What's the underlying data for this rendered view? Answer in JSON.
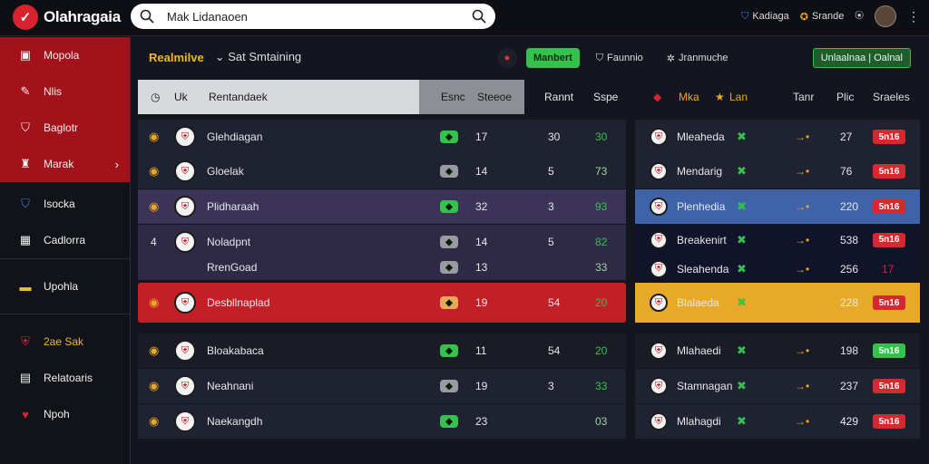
{
  "app": {
    "title": "Olahragaia"
  },
  "search": {
    "value": "Mak Lidanaoen",
    "placeholder": "Search"
  },
  "top": {
    "item1": "Kadiaga",
    "item2": "Srande"
  },
  "sidebar": {
    "items": [
      {
        "label": "Mopola",
        "icon": "ball-icon"
      },
      {
        "label": "Nlis",
        "icon": "pen-icon"
      },
      {
        "label": "Baglotr",
        "icon": "shield-icon"
      },
      {
        "label": "Marak",
        "icon": "trophy-icon"
      },
      {
        "label": "Isocka",
        "icon": "shield-icon"
      },
      {
        "label": "Cadlorra",
        "icon": "card-icon"
      },
      {
        "label": "Upohla",
        "icon": "flag-icon"
      },
      {
        "label": "2ae Sak",
        "icon": "badge-icon"
      },
      {
        "label": "Relatoaris",
        "icon": "calendar-icon"
      },
      {
        "label": "Npoh",
        "icon": "heart-icon"
      }
    ]
  },
  "toolbar": {
    "title": "Realmilve",
    "dropdown": "Sat Smtaining",
    "pill_green": "Manbert",
    "pill1": "Faunnio",
    "pill2": "Jranmuche",
    "update_label": "Unlaalnaa | Oalnal"
  },
  "table_left": {
    "headers": {
      "ul": "Uk",
      "team": "Rentandaek",
      "c1": "Esnc",
      "c2": "Steeoe",
      "c3": "Rannt",
      "c4": "Sspe"
    }
  },
  "table_right": {
    "headers": {
      "h1": "Mka",
      "h2": "Lan",
      "h3": "Tanr",
      "h4": "Plic",
      "h5": "Sraeles"
    }
  },
  "left_rows": [
    {
      "pos": "",
      "team": "Glehdiagan",
      "badge": "17",
      "c2": "30",
      "c3": "30",
      "c4": "30"
    },
    {
      "pos": "",
      "team": "Gloelak",
      "badge": "14",
      "c2": "5",
      "c3": "5",
      "c4": "73"
    },
    {
      "pos": "",
      "team": "Plidharaah",
      "badge": "32",
      "c2": "3",
      "c3": "3",
      "c4": "93"
    },
    {
      "pos": "4",
      "team": "Noladpnt",
      "badge": "14",
      "c2": "5",
      "c3": "5",
      "c4": "82"
    },
    {
      "pos": "",
      "team": "RrenGoad",
      "badge": "13",
      "c2": "",
      "c3": "",
      "c4": "33"
    },
    {
      "pos": "",
      "team": "Desbllnaplad",
      "badge": "19",
      "c2": "54",
      "c3": "54",
      "c4": "20"
    },
    {
      "pos": "",
      "team": "Bloakabaca",
      "badge": "11",
      "c2": "54",
      "c3": "54",
      "c4": "20"
    },
    {
      "pos": "",
      "team": "Neahnani",
      "badge": "19",
      "c2": "3",
      "c3": "3",
      "c4": "33"
    },
    {
      "pos": "",
      "team": "Naekangdh",
      "badge": "23",
      "c2": "",
      "c3": "",
      "c4": "03"
    }
  ],
  "right_rows": [
    {
      "team": "Mleaheda",
      "v1": "27",
      "odd": "5n16"
    },
    {
      "team": "Mendarig",
      "v1": "76",
      "odd": "5n16"
    },
    {
      "team": "Plenhedia",
      "v1": "220",
      "odd": "5n16"
    },
    {
      "team": "Breakenirt",
      "v1": "538",
      "odd": "5n16"
    },
    {
      "team": "Sleahenda",
      "v1": "256",
      "odd": "17"
    },
    {
      "team": "Blalaeda",
      "v1": "228",
      "odd": "5n16"
    },
    {
      "team": "Mlahaedi",
      "v1": "198",
      "odd": "5n16"
    },
    {
      "team": "Stamnagan",
      "v1": "237",
      "odd": "5n16"
    },
    {
      "team": "Mlahagdi",
      "v1": "429",
      "odd": "5n16"
    }
  ],
  "colors": {
    "accent": "#d8232e",
    "green": "#34c24d",
    "purple": "#3b3458",
    "gold": "#e8a828"
  }
}
